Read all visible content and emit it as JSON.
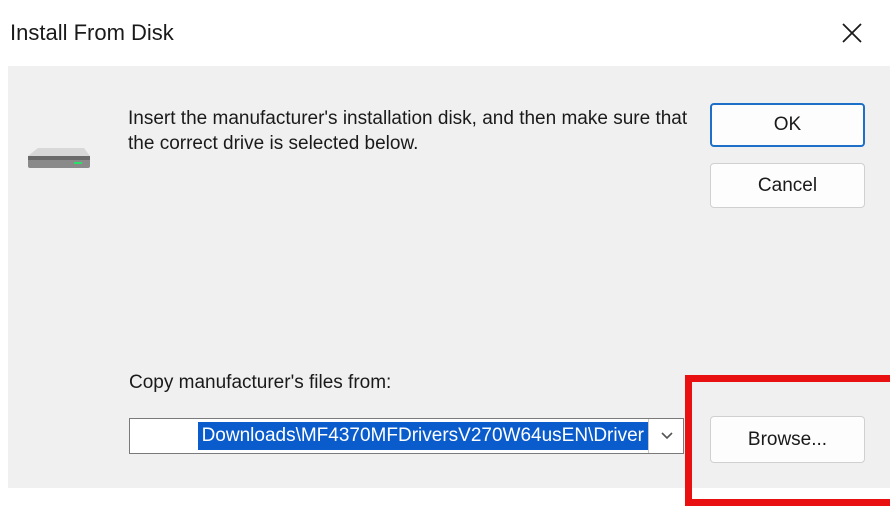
{
  "dialog": {
    "title": "Install From Disk",
    "message": "Insert the manufacturer's installation disk, and then make sure that the correct drive is selected below.",
    "buttons": {
      "ok_label": "OK",
      "cancel_label": "Cancel",
      "browse_label": "Browse..."
    },
    "copy_from": {
      "label": "Copy manufacturer's files from:",
      "value": "Downloads\\MF4370MFDriversV270W64usEN\\Driver"
    },
    "icons": {
      "close": "close-icon",
      "disk": "disk-drive-icon",
      "dropdown": "chevron-down-icon"
    }
  },
  "annotation": {
    "highlight_color": "#e81010"
  },
  "colors": {
    "accent": "#1e6fc8",
    "selection": "#0a5ccc"
  }
}
